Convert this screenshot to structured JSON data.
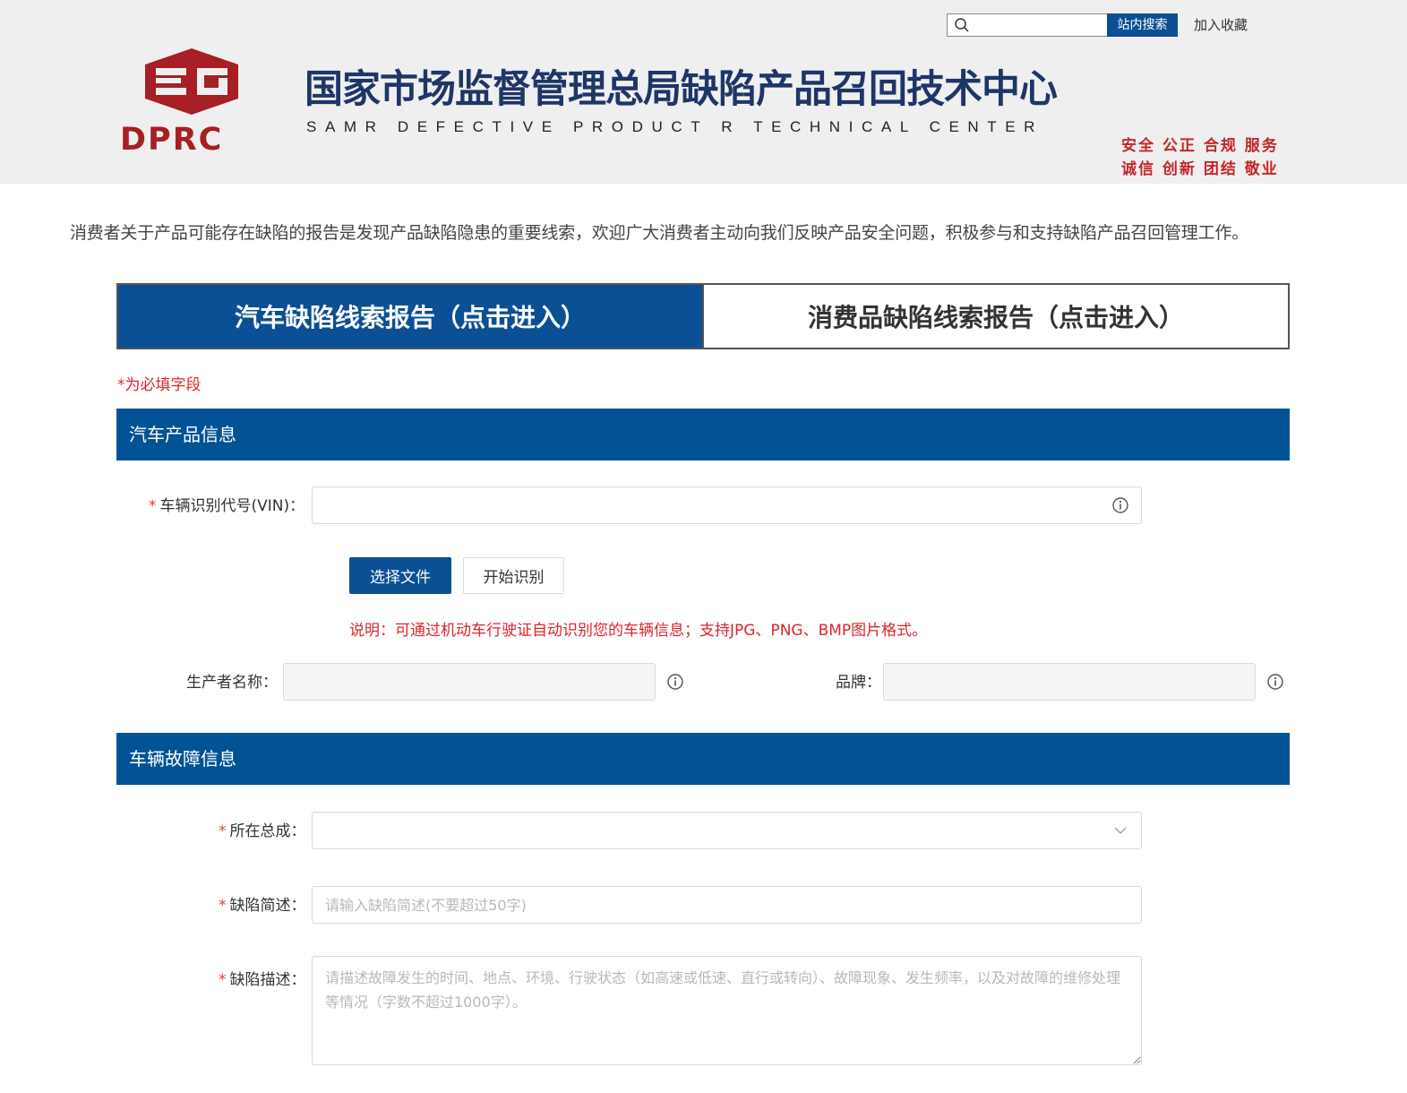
{
  "header": {
    "search_placeholder": "",
    "search_button": "站内搜索",
    "favorite_link": "加入收藏",
    "logo_text": "DPRC",
    "title": "国家市场监督管理总局缺陷产品召回技术中心",
    "subtitle": "SAMR DEFECTIVE PRODUCT R          TECHNICAL CENTER",
    "motto_line1": "安全 公正 合规 服务",
    "motto_line2": "诚信 创新 团结 敬业",
    "brand_color": "#a51f24",
    "title_color": "#1e3567"
  },
  "intro": "消费者关于产品可能存在缺陷的报告是发现产品缺陷隐患的重要线索，欢迎广大消费者主动向我们反映产品安全问题，积极参与和支持缺陷产品召回管理工作。",
  "tabs": [
    {
      "label": "汽车缺陷线索报告（点击进入）",
      "active": true
    },
    {
      "label": "消费品缺陷线索报告（点击进入）",
      "active": false
    }
  ],
  "required_note": "*为必填字段",
  "section_product": {
    "title": "汽车产品信息",
    "vin_label": "车辆识别代号(VIN)：",
    "vin_value": "",
    "choose_file_button": "选择文件",
    "start_recognize_button": "开始识别",
    "note": "说明：可通过机动车行驶证自动识别您的车辆信息；支持JPG、PNG、BMP图片格式。",
    "manufacturer_label": "生产者名称：",
    "manufacturer_value": "",
    "brand_label": "品牌：",
    "brand_value": ""
  },
  "section_fault": {
    "title": "车辆故障信息",
    "assembly_label": "所在总成：",
    "assembly_value": "",
    "summary_label": "缺陷简述：",
    "summary_placeholder": "请输入缺陷简述(不要超过50字)",
    "description_label": "缺陷描述：",
    "description_placeholder": "请描述故障发生的时间、地点、环境、行驶状态（如高速或低速、直行或转向）、故障现象、发生频率，以及对故障的维修处理等情况（字数不超过1000字）。"
  },
  "colors": {
    "primary": "#0b4f95",
    "section_bar": "#025395",
    "required": "#e4393c",
    "note": "#d9262b"
  }
}
